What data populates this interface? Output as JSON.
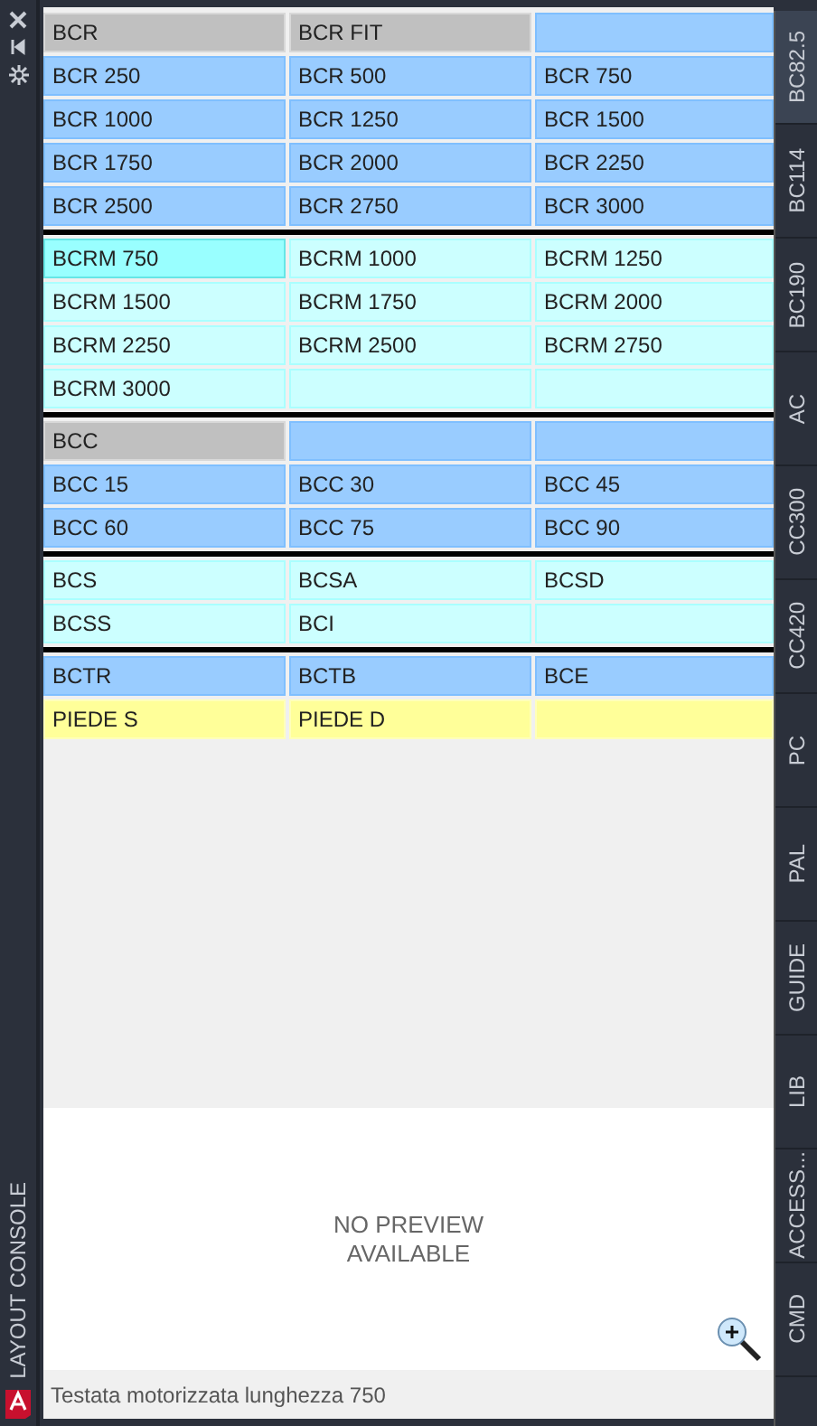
{
  "side_panel": {
    "title": "LAYOUT CONSOLE"
  },
  "groups": [
    {
      "rows": [
        [
          {
            "label": "BCR",
            "color": "#c0c0c0",
            "selected": false
          },
          {
            "label": "BCR FIT",
            "color": "#c0c0c0",
            "selected": false
          },
          {
            "color": "#99ccff",
            "selected": false
          }
        ],
        [
          {
            "label": "BCR 250",
            "color": "#99ccff",
            "selected": false
          },
          {
            "label": "BCR 500",
            "color": "#99ccff",
            "selected": false
          },
          {
            "label": "BCR 750",
            "color": "#99ccff",
            "selected": false
          }
        ],
        [
          {
            "label": "BCR 1000",
            "color": "#99ccff",
            "selected": false
          },
          {
            "label": "BCR 1250",
            "color": "#99ccff",
            "selected": false
          },
          {
            "label": "BCR 1500",
            "color": "#99ccff",
            "selected": false
          }
        ],
        [
          {
            "label": "BCR 1750",
            "color": "#99ccff",
            "selected": false
          },
          {
            "label": "BCR 2000",
            "color": "#99ccff",
            "selected": false
          },
          {
            "label": "BCR 2250",
            "color": "#99ccff",
            "selected": false
          }
        ],
        [
          {
            "label": "BCR 2500",
            "color": "#99ccff",
            "selected": false
          },
          {
            "label": "BCR 2750",
            "color": "#99ccff",
            "selected": false
          },
          {
            "label": "BCR 3000",
            "color": "#99ccff",
            "selected": false
          }
        ]
      ]
    },
    {
      "rows": [
        [
          {
            "label": "BCRM 750",
            "color": "#99ffff",
            "selected": true
          },
          {
            "label": "BCRM 1000",
            "color": "#ccffff",
            "selected": false
          },
          {
            "label": "BCRM 1250",
            "color": "#ccffff",
            "selected": false
          }
        ],
        [
          {
            "label": "BCRM 1500",
            "color": "#ccffff",
            "selected": false
          },
          {
            "label": "BCRM 1750",
            "color": "#ccffff",
            "selected": false
          },
          {
            "label": "BCRM 2000",
            "color": "#ccffff",
            "selected": false
          }
        ],
        [
          {
            "label": "BCRM 2250",
            "color": "#ccffff",
            "selected": false
          },
          {
            "label": "BCRM 2500",
            "color": "#ccffff",
            "selected": false
          },
          {
            "label": "BCRM 2750",
            "color": "#ccffff",
            "selected": false
          }
        ],
        [
          {
            "label": "BCRM 3000",
            "color": "#ccffff",
            "selected": false
          },
          {
            "color": "#ccffff",
            "selected": false
          },
          {
            "color": "#ccffff",
            "selected": false
          }
        ]
      ]
    },
    {
      "rows": [
        [
          {
            "label": "BCC",
            "color": "#c0c0c0",
            "selected": false
          },
          {
            "color": "#99ccff",
            "selected": false
          },
          {
            "color": "#99ccff",
            "selected": false
          }
        ],
        [
          {
            "label": "BCC 15",
            "color": "#99ccff",
            "selected": false
          },
          {
            "label": "BCC 30",
            "color": "#99ccff",
            "selected": false
          },
          {
            "label": "BCC 45",
            "color": "#99ccff",
            "selected": false
          }
        ],
        [
          {
            "label": "BCC 60",
            "color": "#99ccff",
            "selected": false
          },
          {
            "label": "BCC 75",
            "color": "#99ccff",
            "selected": false
          },
          {
            "label": "BCC 90",
            "color": "#99ccff",
            "selected": false
          }
        ]
      ]
    },
    {
      "rows": [
        [
          {
            "label": "BCS",
            "color": "#ccffff",
            "selected": false
          },
          {
            "label": "BCSA",
            "color": "#ccffff",
            "selected": false
          },
          {
            "label": "BCSD",
            "color": "#ccffff",
            "selected": false
          }
        ],
        [
          {
            "label": "BCSS",
            "color": "#ccffff",
            "selected": false
          },
          {
            "label": "BCI",
            "color": "#ccffff",
            "selected": false
          },
          {
            "color": "#ccffff",
            "selected": false
          }
        ]
      ]
    },
    {
      "rows": [
        [
          {
            "label": "BCTR",
            "color": "#99ccff",
            "selected": false
          },
          {
            "label": "BCTB",
            "color": "#99ccff",
            "selected": false
          },
          {
            "label": "BCE",
            "color": "#99ccff",
            "selected": false
          }
        ],
        [
          {
            "label": "PIEDE S",
            "color": "#ffff99",
            "selected": false
          },
          {
            "label": "PIEDE D",
            "color": "#ffff99",
            "selected": false
          },
          {
            "color": "#ffff99",
            "selected": false
          }
        ]
      ]
    }
  ],
  "preview": {
    "message": "NO PREVIEW\nAVAILABLE"
  },
  "status_bar": "Testata motorizzata lunghezza 750",
  "tabs": [
    {
      "label": "BC82.5",
      "selected": true
    },
    {
      "label": "BC114",
      "selected": false
    },
    {
      "label": "BC190",
      "selected": false
    },
    {
      "label": "AC",
      "selected": false
    },
    {
      "label": "CC300",
      "selected": false
    },
    {
      "label": "CC420",
      "selected": false
    },
    {
      "label": "PC",
      "selected": false
    },
    {
      "label": "PAL",
      "selected": false
    },
    {
      "label": "GUIDE",
      "selected": false
    },
    {
      "label": "LIB",
      "selected": false
    },
    {
      "label": "ACCESS...",
      "selected": false
    },
    {
      "label": "CMD",
      "selected": false
    }
  ]
}
